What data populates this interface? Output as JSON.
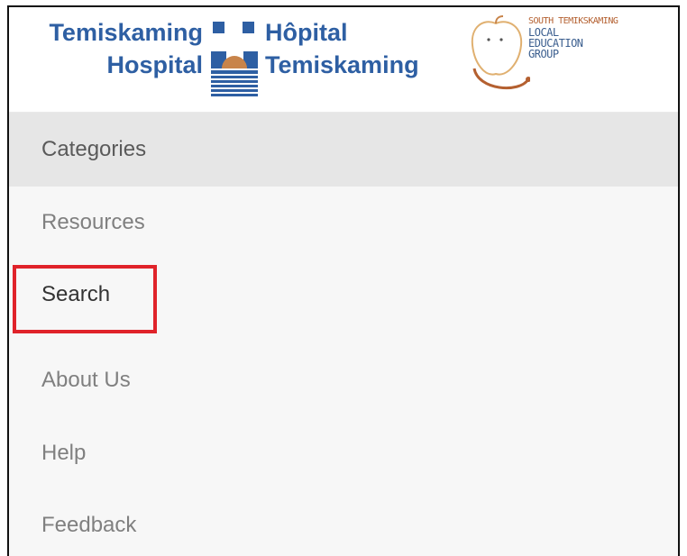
{
  "header": {
    "hospital_en_line1": "Temiskaming",
    "hospital_en_line2": "Hospital",
    "hospital_fr_line1": "Hôpital",
    "hospital_fr_line2": "Temiskaming",
    "legal_logo_lines": [
      "SOUTH TEMIKSKAMING",
      "LOCAL",
      "EDUCATION",
      "GROUP"
    ],
    "brand_color": "#2e5fa3"
  },
  "nav": {
    "items": [
      {
        "label": "Categories",
        "state": "active"
      },
      {
        "label": "Resources"
      },
      {
        "label": "Search",
        "highlighted": true
      },
      {
        "label": "About Us"
      },
      {
        "label": "Help"
      },
      {
        "label": "Feedback"
      }
    ]
  },
  "annotation": {
    "highlight_color": "#e0232a",
    "target": "Search"
  }
}
